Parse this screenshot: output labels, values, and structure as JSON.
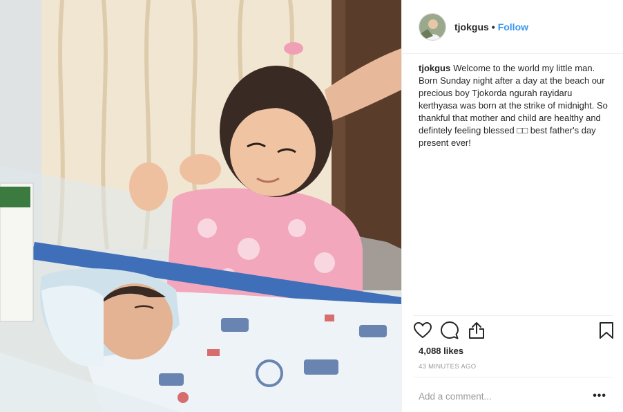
{
  "post": {
    "username": "tjokgus",
    "separator": "•",
    "follow_label": "Follow",
    "caption": {
      "username": "tjokgus",
      "text": "Welcome to the world my little man. Born Sunday night after a day at the beach our precious boy Tjokorda ngurah rayidaru kerthyasa was born at the strike of midnight. So thankful that mother and child are healthy and defintely feeling blessed □□ best father's day present ever!"
    },
    "likes": "4,088 likes",
    "timestamp": "43 MINUTES AGO",
    "comment": {
      "placeholder": "Add a comment...",
      "more_label": "•••"
    },
    "icons": {
      "like": "heart-icon",
      "comment": "speech-bubble-icon",
      "share": "share-icon",
      "save": "bookmark-icon",
      "more": "ellipsis-icon"
    },
    "colors": {
      "link": "#3897f0",
      "text": "#262626",
      "muted": "#999999",
      "divider": "#efefef"
    }
  }
}
